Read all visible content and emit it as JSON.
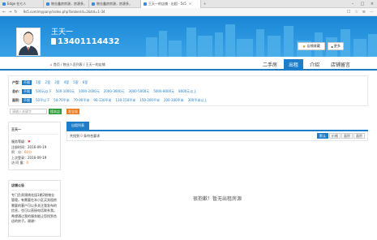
{
  "browser": {
    "tabs": [
      {
        "label": "Edge 在七人",
        "active": false
      },
      {
        "label": "物业鑫房房源，房源多，",
        "active": false
      },
      {
        "label": "物业鑫房房源，房源多，",
        "active": false
      },
      {
        "label": "王天一的店铺 · 出租 · 5s5",
        "active": true
      }
    ],
    "url": "9s5.com/mypany/index.php?brokerid=2&tid=1-34"
  },
  "header": {
    "name": "王天一",
    "phone": "13401114432",
    "collect_label": "店铺收藏",
    "more_label": "更多"
  },
  "breadcrumb": "首页 / 物业人员列表 / 王天一的店铺",
  "nav_tabs": [
    {
      "label": "二手房",
      "active": false
    },
    {
      "label": "出租",
      "active": true
    },
    {
      "label": "介绍",
      "active": false
    },
    {
      "label": "店铺留言",
      "active": false
    }
  ],
  "filters": {
    "type": {
      "label": "户型：",
      "options": [
        "不限",
        "1室",
        "2室",
        "3室",
        "4室",
        "5室",
        "6室"
      ]
    },
    "price": {
      "label": "总价：",
      "options": [
        "不限",
        "500元以下",
        "500-1000元",
        "1000-2000元",
        "2000-3000元",
        "3000-5000元",
        "5000-8000元",
        "8000元以上"
      ]
    },
    "area": {
      "label": "面积：",
      "options": [
        "不限",
        "50平以下",
        "50-70平米",
        "70-90平米",
        "90-130平米",
        "130-150平米",
        "150-200平米",
        "200-300平米",
        "300平米以上"
      ]
    }
  },
  "search": {
    "placeholder": "请输入关键字",
    "search_label": "搜本店",
    "publish_label": "发全站"
  },
  "agent": {
    "name": "王天一",
    "service_label": "服务等级：",
    "register_label": "注册时间：",
    "register_value": "2016-09-19",
    "points_label": "积　分：",
    "points_value": "60分",
    "last_login_label": "上次登录：",
    "last_login_value": "2016-09-19",
    "visits_label": "访 问 量：",
    "visits_value": "0"
  },
  "notice": {
    "title": "店铺公告",
    "body": "专门负责锦绣花园1期2期物业管理。有需要在本小区买卖租房需要的客户可以多关注我发布的信息，也可以直接电话联系我。希望通过我的服务能让您找到合适的房子。谢谢！"
  },
  "listing": {
    "tab_label": "出租列表",
    "count_prefix": "共找到",
    "count_value": "0",
    "count_suffix": "条符合要求",
    "sort_options": [
      "默认",
      "价格",
      "面积",
      "面积"
    ],
    "empty_text": "很抱歉！暂无出租房源"
  }
}
